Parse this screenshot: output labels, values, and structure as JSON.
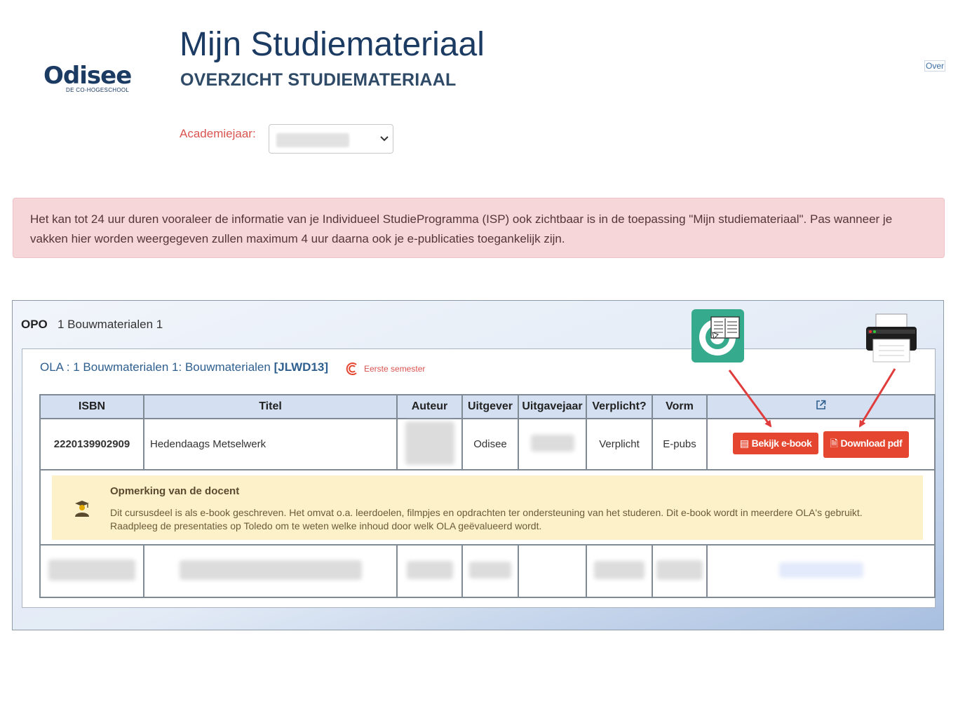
{
  "brand": {
    "name": "Odisee",
    "tagline": "DE CO-HOGESCHOOL"
  },
  "header": {
    "title": "Mijn Studiemateriaal",
    "subtitle": "OVERZICHT STUDIEMATERIAAL",
    "over_link": "Over"
  },
  "filters": {
    "year_label": "Academiejaar:"
  },
  "alert": {
    "text": "Het kan tot 24 uur duren vooraleer de informatie van je Individueel StudieProgramma (ISP) ook zichtbaar is in de toepassing \"Mijn studiemateriaal\". Pas wanneer je vakken hier worden weergegeven zullen maximum 4 uur daarna ook je e-publicaties toegankelijk zijn."
  },
  "opo": {
    "label": "OPO",
    "name": "1 Bouwmaterialen 1"
  },
  "ola": {
    "prefix": "OLA : 1 Bouwmaterialen 1: Bouwmaterialen",
    "code": "[JLWD13]",
    "semester": "Eerste semester"
  },
  "table": {
    "headers": [
      "ISBN",
      "Titel",
      "Auteur",
      "Uitgever",
      "Uitgavejaar",
      "Verplicht?",
      "Vorm"
    ],
    "rows": [
      {
        "isbn": "2220139902909",
        "titel": "Hedendaags Metselwerk",
        "uitgever": "Odisee",
        "verplicht": "Verplicht",
        "vorm": "E-pubs"
      }
    ],
    "buttons": {
      "ebook": "Bekijk e-book",
      "pdf": "Download pdf"
    }
  },
  "note": {
    "title": "Opmerking van de docent",
    "text": "Dit cursusdeel is als e-book geschreven. Het omvat o.a. leerdoelen, filmpjes en opdrachten ter ondersteuning van het studeren. Dit e-book wordt in meerdere OLA's gebruikt. Raadpleeg de presentaties op Toledo om te weten welke inhoud door welk OLA geëvalueerd wordt."
  },
  "colors": {
    "primary": "#1c3b63",
    "accent_red": "#e4462f",
    "alert_bg": "#f6d6d9",
    "note_bg": "#fcf1c8",
    "header_bg": "#d4e0f1",
    "reader_green": "#35aa8c"
  },
  "icons": {
    "reader": "ebook-reader-icon",
    "printer": "printer-icon",
    "external": "external-link-icon",
    "teacher": "teacher-icon",
    "semester": "semester-icon"
  }
}
